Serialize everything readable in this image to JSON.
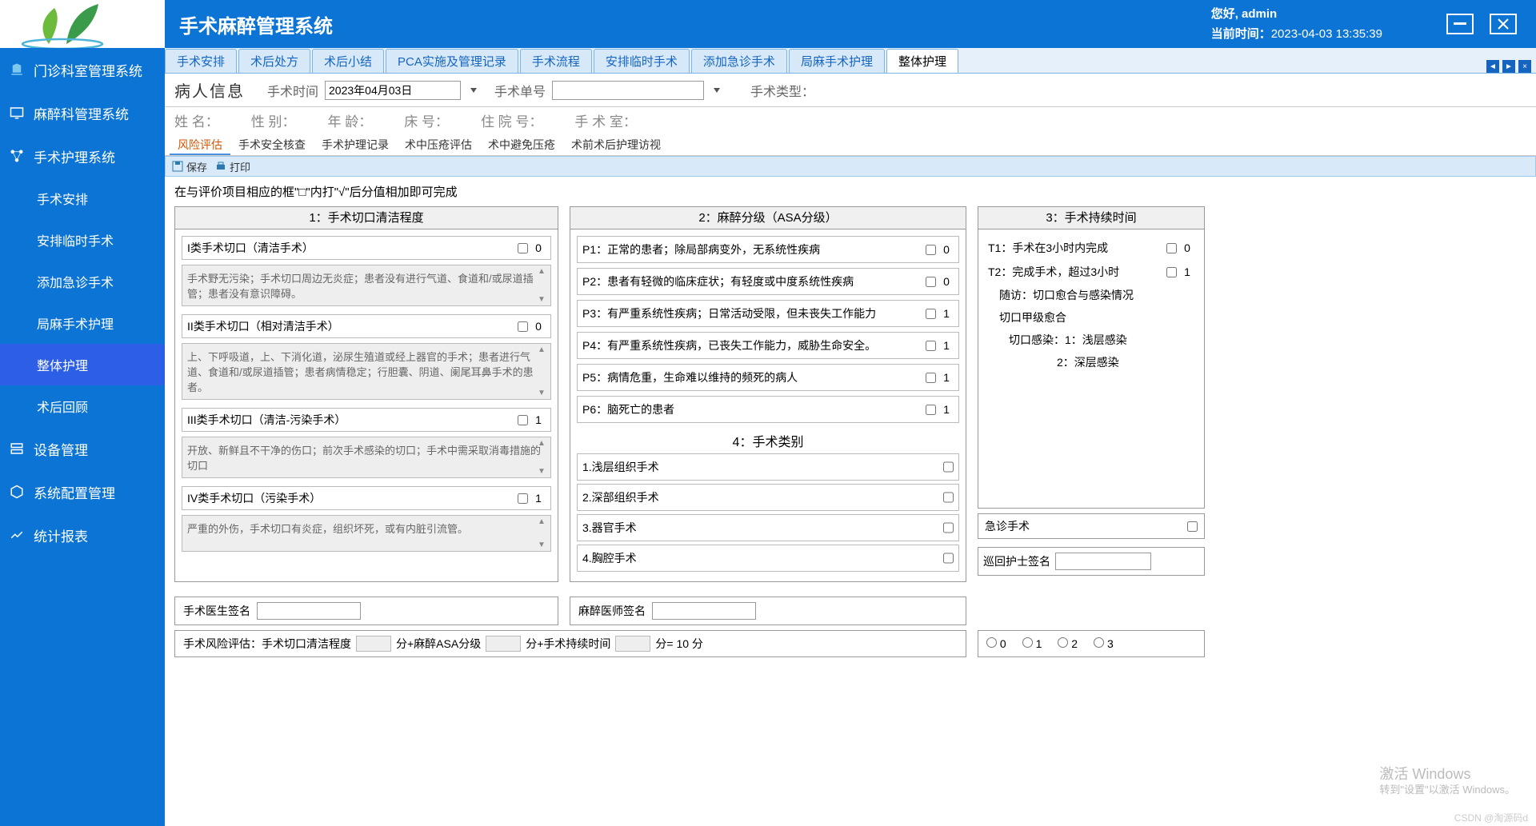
{
  "header": {
    "app_title": "手术麻醉管理系统",
    "greeting": "您好, ",
    "user": "admin",
    "time_label": "当前时间：",
    "time": "2023-04-03 13:35:39"
  },
  "sidebar": {
    "items": [
      {
        "label": "门诊科室管理系统"
      },
      {
        "label": "麻醉科管理系统"
      },
      {
        "label": "手术护理系统"
      },
      {
        "label": "设备管理"
      },
      {
        "label": "系统配置管理"
      },
      {
        "label": "统计报表"
      }
    ],
    "subs": [
      {
        "label": "手术安排"
      },
      {
        "label": "安排临时手术"
      },
      {
        "label": "添加急诊手术"
      },
      {
        "label": "局麻手术护理"
      },
      {
        "label": "整体护理"
      },
      {
        "label": "术后回顾"
      }
    ]
  },
  "tabs": {
    "items": [
      "手术安排",
      "术后处方",
      "术后小结",
      "PCA实施及管理记录",
      "手术流程",
      "安排临时手术",
      "添加急诊手术",
      "局麻手术护理",
      "整体护理"
    ]
  },
  "info": {
    "patient_label": "病人信息",
    "op_time_label": "手术时间",
    "op_time": "2023年04月03日",
    "op_no_label": "手术单号",
    "op_type_label": "手术类型：",
    "row2": {
      "name": "姓    名：",
      "sex": "性    别：",
      "age": "年    龄：",
      "bed": "床    号：",
      "hosp": "住 院 号：",
      "room": "手 术 室："
    }
  },
  "subtabs": {
    "items": [
      "风险评估",
      "手术安全核查",
      "手术护理记录",
      "术中压疮评估",
      "术中避免压疮",
      "术前术后护理访视"
    ]
  },
  "toolbar": {
    "save": "保存",
    "print": "打印"
  },
  "hint": "在与评价项目相应的框\"□\"内打\"√\"后分值相加即可完成",
  "panel1": {
    "title": "1：手术切口清洁程度",
    "rows": [
      {
        "label": "I类手术切口（清洁手术）",
        "val": "0",
        "desc": "手术野无污染；手术切口周边无炎症；患者没有进行气道、食道和/或尿道插管；患者没有意识障碍。"
      },
      {
        "label": "II类手术切口（相对清洁手术）",
        "val": "0",
        "desc": "上、下呼吸道，上、下消化道，泌尿生殖道或经上器官的手术；患者进行气道、食道和/或尿道插管；患者病情稳定；行胆囊、阴道、阑尾耳鼻手术的患者。"
      },
      {
        "label": "III类手术切口（清洁-污染手术）",
        "val": "1",
        "desc": "开放、新鲜且不干净的伤口；前次手术感染的切口；手术中需采取消毒措施的切口"
      },
      {
        "label": "IV类手术切口（污染手术）",
        "val": "1",
        "desc": "严重的外伤，手术切口有炎症，组织坏死，或有内脏引流管。"
      }
    ]
  },
  "panel2": {
    "title": "2：麻醉分级（ASA分级）",
    "rows": [
      {
        "label": "P1：正常的患者；除局部病变外，无系统性疾病",
        "val": "0"
      },
      {
        "label": "P2：患者有轻微的临床症状；有轻度或中度系统性疾病",
        "val": "0"
      },
      {
        "label": "P3：有严重系统性疾病；日常活动受限，但未丧失工作能力",
        "val": "1"
      },
      {
        "label": "P4：有严重系统性疾病，已丧失工作能力，威胁生命安全。",
        "val": "1"
      },
      {
        "label": "P5：病情危重，生命难以维持的频死的病人",
        "val": "1"
      },
      {
        "label": "P6：脑死亡的患者",
        "val": "1"
      }
    ],
    "surg_title": "4：手术类别",
    "surg": [
      "1.浅层组织手术",
      "2.深部组织手术",
      "3.器官手术",
      "4.胸腔手术"
    ]
  },
  "panel3": {
    "title": "3：手术持续时间",
    "rows": [
      {
        "label": "T1：手术在3小时内完成",
        "val": "0"
      },
      {
        "label": "T2：完成手术，超过3小时",
        "val": "1"
      }
    ],
    "follow": "随访：切口愈合与感染情况",
    "grade": "切口甲级愈合",
    "inf1": "切口感染：1：浅层感染",
    "inf2": "2：深层感染",
    "emerg": "急诊手术",
    "nurse_sig": "巡回护士签名"
  },
  "sig": {
    "surgeon": "手术医生签名",
    "anesth": "麻醉医师签名"
  },
  "score": {
    "label": "手术风险评估：手术切口清洁程度",
    "p2": "分+麻醉ASA分级",
    "p3": "分+手术持续时间",
    "p4": "分= 10 分"
  },
  "radios": [
    "0",
    "1",
    "2",
    "3"
  ],
  "watermark": {
    "l1": "激活 Windows",
    "l2": "转到\"设置\"以激活 Windows。"
  },
  "csdn": "CSDN @淘源码d"
}
